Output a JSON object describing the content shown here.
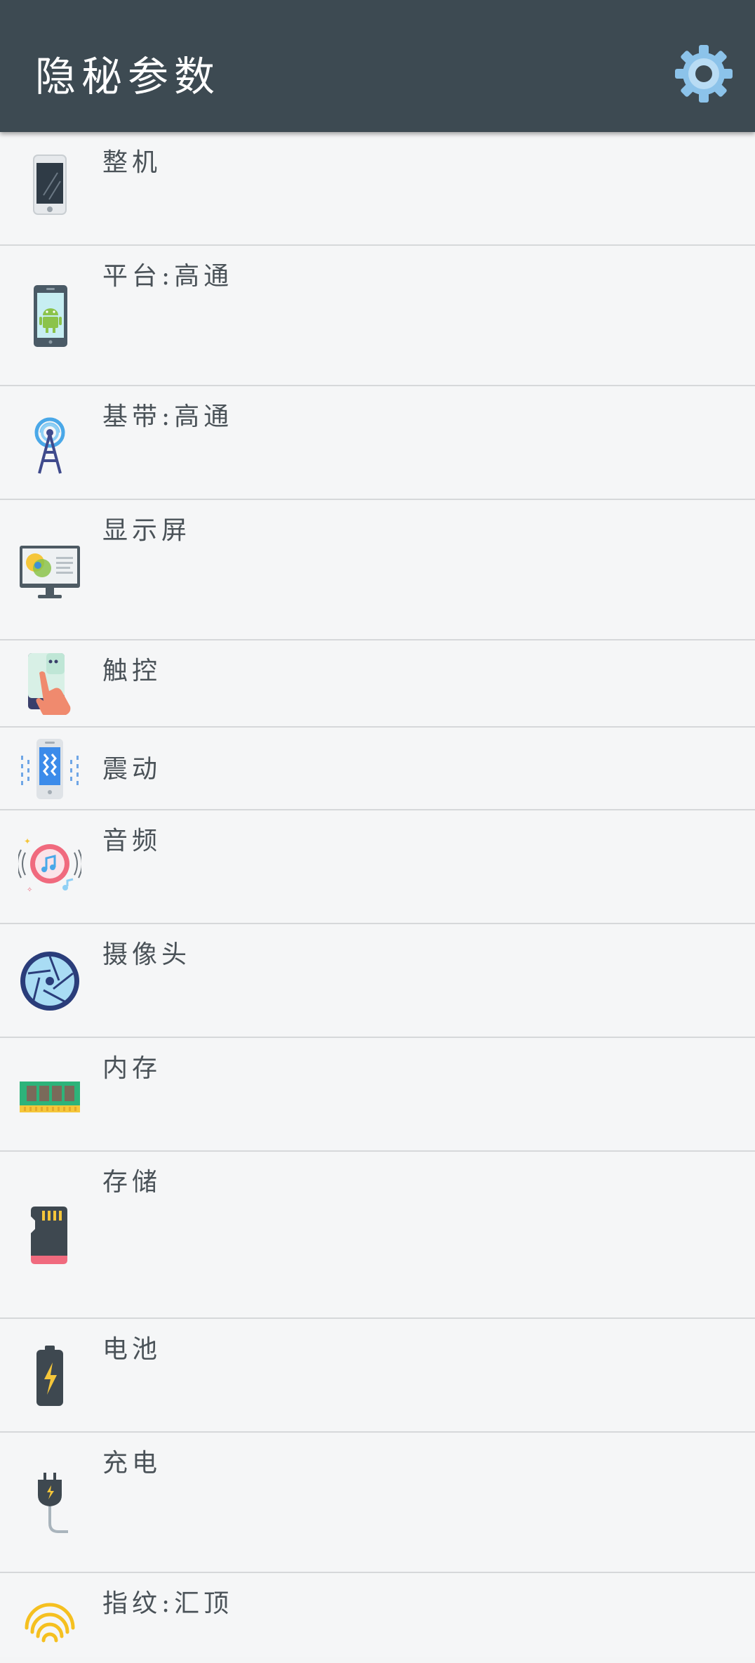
{
  "app": {
    "title": "隐秘参数"
  },
  "list": {
    "items": [
      {
        "label": "整机",
        "icon": "phone-icon"
      },
      {
        "label": "平台:高通",
        "icon": "android-phone-icon"
      },
      {
        "label": "基带:高通",
        "icon": "signal-tower-icon"
      },
      {
        "label": "显示屏",
        "icon": "monitor-icon"
      },
      {
        "label": "触控",
        "icon": "touch-hand-icon"
      },
      {
        "label": "震动",
        "icon": "vibration-icon"
      },
      {
        "label": "音频",
        "icon": "music-icon"
      },
      {
        "label": "摄像头",
        "icon": "camera-aperture-icon"
      },
      {
        "label": "内存",
        "icon": "ram-icon"
      },
      {
        "label": "存储",
        "icon": "sd-card-icon"
      },
      {
        "label": "电池",
        "icon": "battery-icon"
      },
      {
        "label": "充电",
        "icon": "plug-icon"
      },
      {
        "label": "指纹:汇顶",
        "icon": "fingerprint-icon"
      }
    ]
  },
  "colors": {
    "appbar": "#3d4a52",
    "divider": "#d6d8da",
    "text": "#4a5258",
    "gear": "#7fb8e3"
  }
}
